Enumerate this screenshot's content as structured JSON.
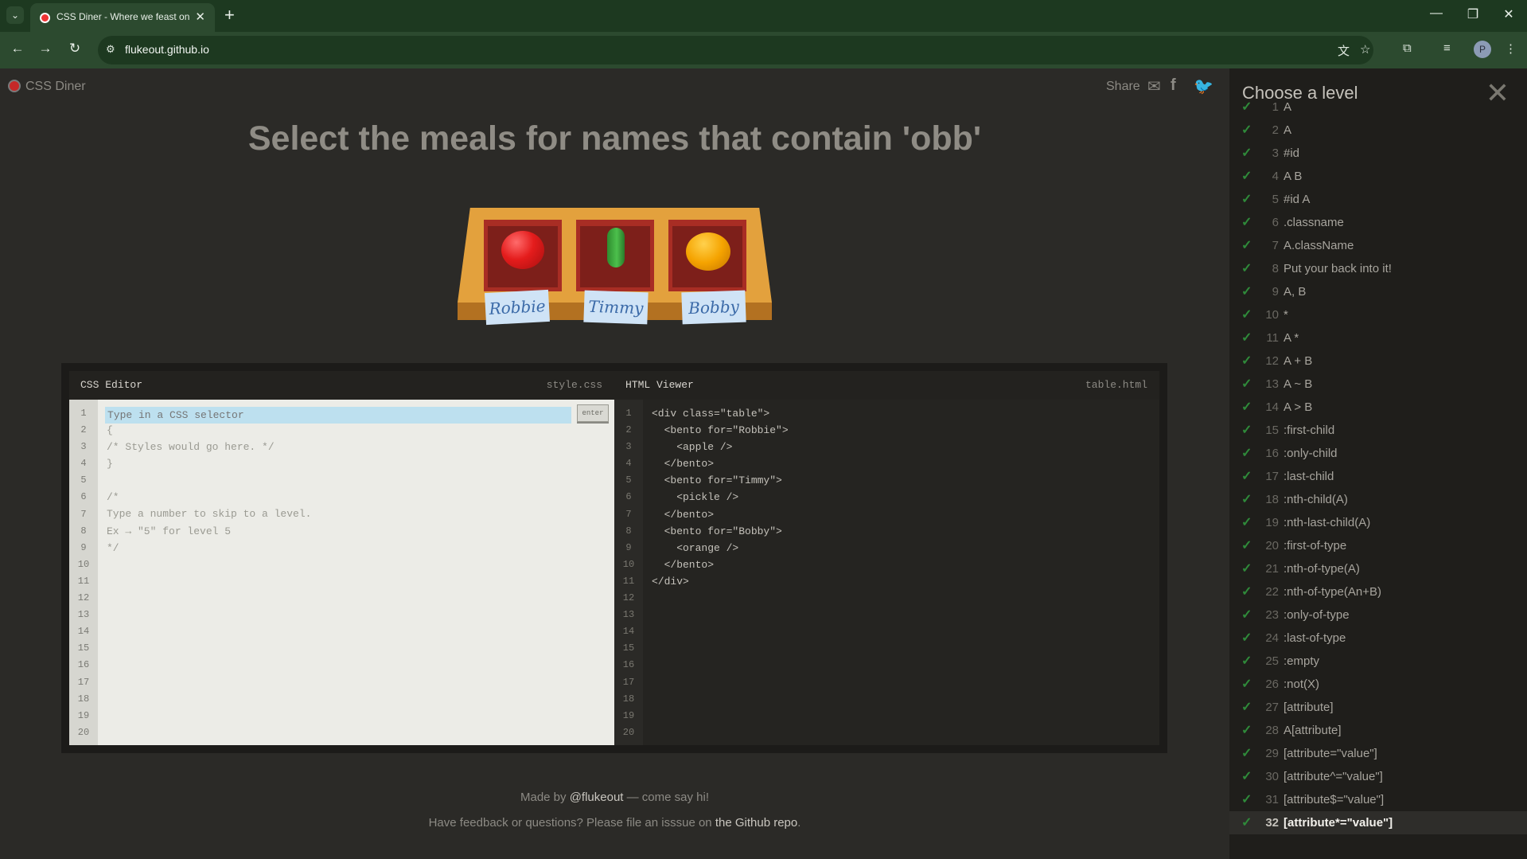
{
  "browser": {
    "tab_title": "CSS Diner - Where we feast on",
    "url": "flukeout.github.io",
    "profile_initial": "P"
  },
  "header": {
    "logo_text": "CSS Diner",
    "share_label": "Share"
  },
  "order_text": "Select the meals for names that contain 'obb'",
  "table": {
    "bentos": [
      {
        "name": "Robbie",
        "item": "apple"
      },
      {
        "name": "Timmy",
        "item": "pickle"
      },
      {
        "name": "Bobby",
        "item": "orange"
      }
    ]
  },
  "css_editor": {
    "title": "CSS Editor",
    "filename": "style.css",
    "placeholder": "Type in a CSS selector",
    "enter_label": "enter",
    "lines": [
      "{",
      "/* Styles would go here. */",
      "}",
      "",
      "/*",
      "Type a number to skip to a level.",
      "Ex → \"5\" for level 5",
      "*/"
    ],
    "line_numbers": "1\n2\n3\n4\n5\n6\n7\n8\n9\n10\n11\n12\n13\n14\n15\n16\n17\n18\n19\n20"
  },
  "html_viewer": {
    "title": "HTML Viewer",
    "filename": "table.html",
    "code": "<div class=\"table\">\n  <bento for=\"Robbie\">\n    <apple />\n  </bento>\n  <bento for=\"Timmy\">\n    <pickle />\n  </bento>\n  <bento for=\"Bobby\">\n    <orange />\n  </bento>\n</div>",
    "line_numbers": "1\n2\n3\n4\n5\n6\n7\n8\n9\n10\n11\n12\n13\n14\n15\n16\n17\n18\n19\n20"
  },
  "footer": {
    "made_by_prefix": "Made by ",
    "made_by_author": "@flukeout",
    "made_by_suffix": " — come say hi!",
    "feedback_prefix": "Have feedback or questions? Please file an isssue on ",
    "feedback_link": "the Github repo",
    "feedback_suffix": "."
  },
  "sidebar": {
    "title": "Choose a level",
    "current_level": 32,
    "levels": [
      {
        "num": "1",
        "name": "A"
      },
      {
        "num": "2",
        "name": "A"
      },
      {
        "num": "3",
        "name": "#id"
      },
      {
        "num": "4",
        "name": "A  B"
      },
      {
        "num": "5",
        "name": "#id  A"
      },
      {
        "num": "6",
        "name": ".classname"
      },
      {
        "num": "7",
        "name": "A.className"
      },
      {
        "num": "8",
        "name": "Put your back into it!"
      },
      {
        "num": "9",
        "name": "A, B"
      },
      {
        "num": "10",
        "name": "*"
      },
      {
        "num": "11",
        "name": "A  *"
      },
      {
        "num": "12",
        "name": "A + B"
      },
      {
        "num": "13",
        "name": "A ~ B"
      },
      {
        "num": "14",
        "name": "A > B"
      },
      {
        "num": "15",
        "name": ":first-child"
      },
      {
        "num": "16",
        "name": ":only-child"
      },
      {
        "num": "17",
        "name": ":last-child"
      },
      {
        "num": "18",
        "name": ":nth-child(A)"
      },
      {
        "num": "19",
        "name": ":nth-last-child(A)"
      },
      {
        "num": "20",
        "name": ":first-of-type"
      },
      {
        "num": "21",
        "name": ":nth-of-type(A)"
      },
      {
        "num": "22",
        "name": ":nth-of-type(An+B)"
      },
      {
        "num": "23",
        "name": ":only-of-type"
      },
      {
        "num": "24",
        "name": ":last-of-type"
      },
      {
        "num": "25",
        "name": ":empty"
      },
      {
        "num": "26",
        "name": ":not(X)"
      },
      {
        "num": "27",
        "name": "[attribute]"
      },
      {
        "num": "28",
        "name": "A[attribute]"
      },
      {
        "num": "29",
        "name": "[attribute=\"value\"]"
      },
      {
        "num": "30",
        "name": "[attribute^=\"value\"]"
      },
      {
        "num": "31",
        "name": "[attribute$=\"value\"]"
      },
      {
        "num": "32",
        "name": "[attribute*=\"value\"]"
      }
    ]
  }
}
